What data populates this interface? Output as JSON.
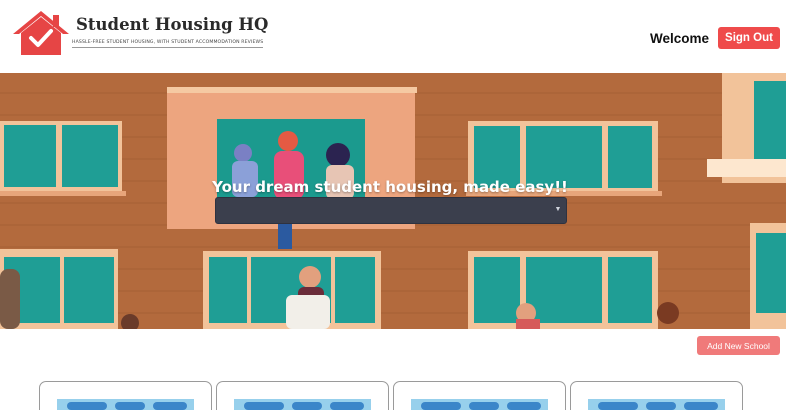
{
  "header": {
    "brand_title": "Student Housing HQ",
    "brand_tagline": "HASSLE-FREE STUDENT HOUSING, WITH STUDENT ACCOMMODATION REVIEWS",
    "welcome_text": "Welcome",
    "signout_label": "Sign Out"
  },
  "hero": {
    "title": "Your dream student housing, made easy!!",
    "select_value": ""
  },
  "actions": {
    "add_school_label": "Add New School"
  },
  "colors": {
    "accent_red": "#ef4b4b",
    "add_button": "#f07a7a",
    "select_bg": "#3b3f4d",
    "wall_brown": "#b36a3d",
    "window_teal": "#23a29a"
  },
  "icons": [
    "house-check-logo-icon",
    "chevron-down-icon"
  ]
}
